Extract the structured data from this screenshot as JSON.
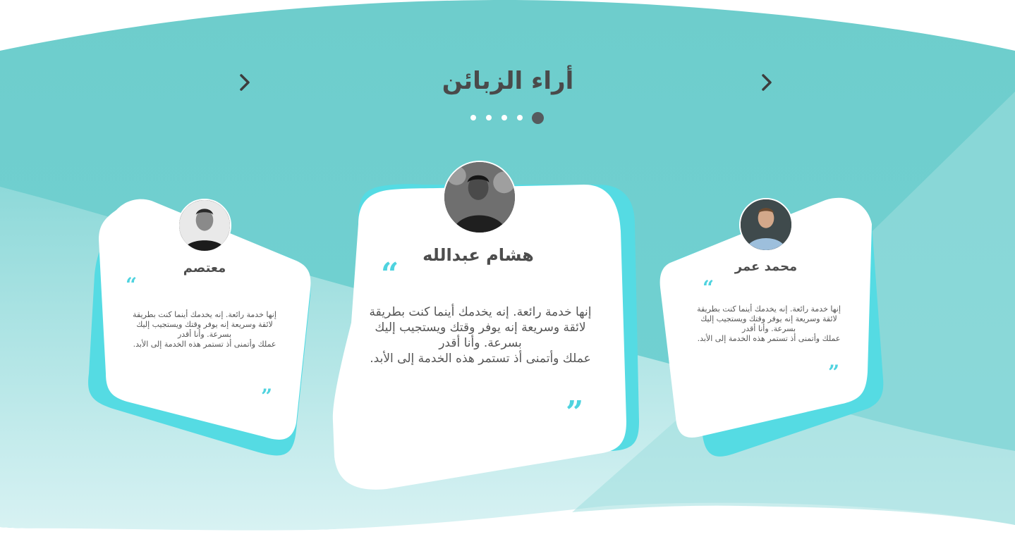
{
  "section": {
    "title": "أراء الزبائن",
    "prev_icon": "chevron-left-icon",
    "next_icon": "chevron-right-icon",
    "slides_total": 5,
    "active_slide": 1
  },
  "colors": {
    "teal": "#6ecdcc",
    "cyan_accent": "#55dbe3",
    "quote": "#4fd3df",
    "title": "#4a4a4a"
  },
  "testimonials": [
    {
      "name": "معتصم",
      "lines": [
        "إنها خدمة رائعة. إنه يخدمك أينما كنت بطريقة",
        "لائقة وسريعة إنه يوفر وقتك ويستجيب إليك",
        "بسرعة. وأنا أقدر",
        "عملك وأتمنى أذ تستمر هذه الخدمة إلى الأبد."
      ],
      "avatar": "avatar-photo"
    },
    {
      "name": "هشام عبدالله",
      "lines": [
        "إنها خدمة رائعة. إنه يخدمك أينما كنت بطريقة",
        "لائقة وسريعة إنه يوفر وقتك ويستجيب إليك",
        "بسرعة. وأنا أقدر",
        "عملك وأتمنى أذ تستمر هذه الخدمة إلى الأبد."
      ],
      "avatar": "avatar-photo"
    },
    {
      "name": "محمد عمر",
      "lines": [
        "إنها خدمة رائعة. إنه يخدمك أينما كنت بطريقة",
        "لائقة وسريعة إنه يوفر وقتك ويستجيب إليك",
        "بسرعة. وأنا أقدر",
        "عملك وأتمنى أذ تستمر هذه الخدمة إلى الأبد."
      ],
      "avatar": "avatar-photo"
    }
  ],
  "quote_open": "“",
  "quote_close": "”"
}
